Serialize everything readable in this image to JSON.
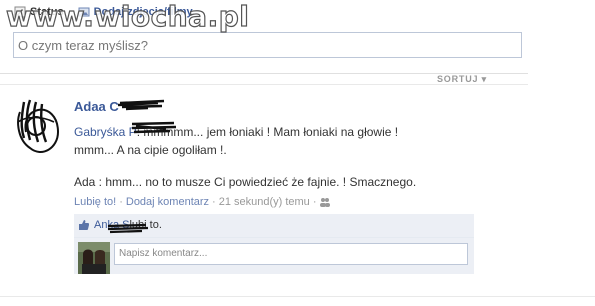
{
  "watermark": "www.wiocha.pl",
  "composer": {
    "tabs": [
      {
        "label": "Status",
        "icon": "pencil-icon"
      },
      {
        "label": "Dodaj zdjęcia/filmy",
        "icon": "photo-icon"
      }
    ],
    "placeholder": "O czym teraz myślisz?"
  },
  "feed": {
    "sort_label": "SORTUJ",
    "story": {
      "author": "Adaa C",
      "lines": [
        {
          "name": "Gabryśka P",
          "text": ": mmmmm... jem łoniaki ! Mam łoniaki na głowie !"
        },
        {
          "text": "mmm... A na cipie ogoliłam !."
        },
        {
          "text": "Ada : hmm... no to musze Ci powiedzieć że fajnie. ! Smacznego."
        }
      ],
      "actions": {
        "like": "Lubię to!",
        "comment": "Dodaj komentarz",
        "time": "21 sekund(y) temu"
      },
      "likes": {
        "names": "Anka S",
        "suffix": " lubi to."
      },
      "comment_placeholder": "Napisz komentarz..."
    }
  },
  "colors": {
    "link": "#3b5998",
    "meta": "#999999",
    "ufi_bg": "#eceff5"
  }
}
